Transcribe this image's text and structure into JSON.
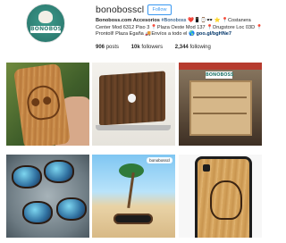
{
  "profile": {
    "username": "bonobosscl",
    "follow_label": "Follow",
    "avatar_text": "BONOBOSS",
    "bio": {
      "name": "Bonoboss.com Accesorios",
      "hashtag": "#Bonoboss",
      "line1_rest": "❤️📱⌚🕶️",
      "line2": "⭐ 📍Costanera Center Mod 6312 Piso 3 📍Plaza Oeste Mod 137 📍Drugstore Loc 03D 📍Prontoll! Plaza Egaña 🚚Envíos a todo el 🌎",
      "link": "goo.gl/bgHNe7"
    },
    "stats": {
      "posts_count": "906",
      "posts_label": "posts",
      "followers_count": "10k",
      "followers_label": "followers",
      "following_count": "2,344",
      "following_label": "following"
    }
  },
  "grid": {
    "posts": [
      {
        "icon": "wooden-skull-phone-case"
      },
      {
        "icon": "wood-laptop-skin"
      },
      {
        "icon": "store-display"
      },
      {
        "icon": "sunglasses-pebbles"
      },
      {
        "icon": "beach-palm-sunglasses",
        "badge": "bonobosscl"
      },
      {
        "icon": "wood-portrait-phone-case"
      }
    ]
  }
}
